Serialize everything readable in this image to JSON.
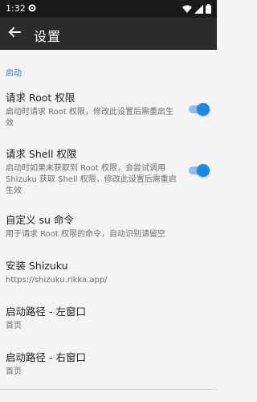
{
  "status_bar": {
    "time": "1:32"
  },
  "app_bar": {
    "title": "设置"
  },
  "section": {
    "header": "启动"
  },
  "items": [
    {
      "title": "请求 Root 权限",
      "subtitle": "启动时请求 Root 权限，修改此设置后需重启生效",
      "switch_on": true
    },
    {
      "title": "请求 Shell 权限",
      "subtitle": "启动时如果未获取到 Root 权限，会尝试调用 Shizuku 获取 Shell 权限，修改此设置后需重启生效",
      "switch_on": true
    },
    {
      "title": "自定义 su 命令",
      "subtitle": "用于请求 Root 权限的命令，自动识别请留空"
    },
    {
      "title": "安装 Shizuku",
      "subtitle": "https://shizuku.rikka.app/"
    },
    {
      "title": "启动路径 - 左窗口",
      "subtitle": "首页"
    },
    {
      "title": "启动路径 - 右窗口",
      "subtitle": "首页"
    }
  ],
  "colors": {
    "accent": "#1e88e5",
    "app_bar": "#2b2b2b",
    "status_bar": "#1a1a1a"
  },
  "icons": [
    "settings-gear-icon",
    "wifi-icon",
    "cellular-signal-icon",
    "battery-icon",
    "back-arrow-icon"
  ]
}
